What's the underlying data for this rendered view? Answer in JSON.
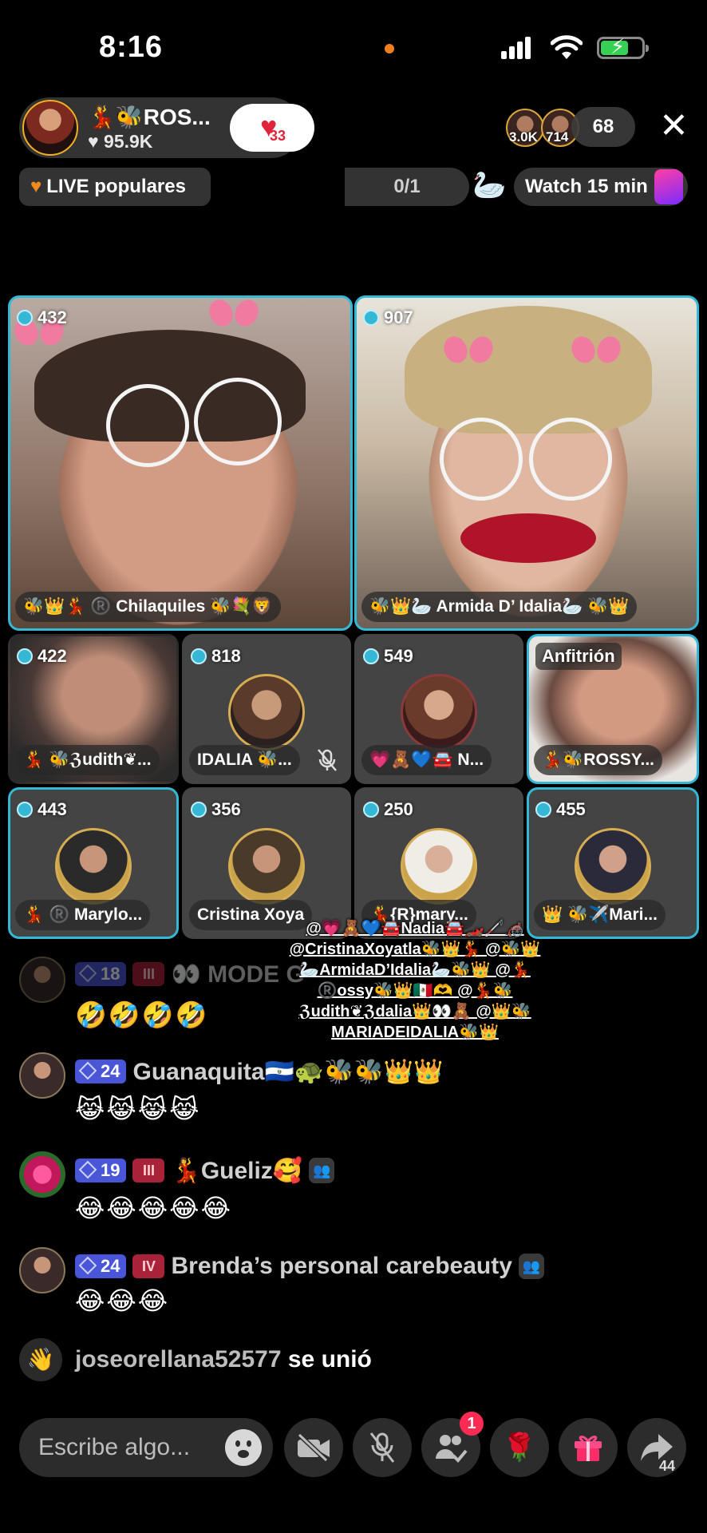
{
  "status": {
    "time": "8:16"
  },
  "host": {
    "name": "💃🐝ROS...",
    "likes": "95.9K",
    "follow_count": "33"
  },
  "viewers": {
    "top": [
      "3.0K",
      "714"
    ],
    "count": "68"
  },
  "pills": {
    "popular": "LIVE populares",
    "progress": "0/1",
    "watch": "Watch 15 min"
  },
  "tiles": [
    {
      "score": "432",
      "label": "🐝👑💃 ®️ Chilaquiles 🐝💐🦁"
    },
    {
      "score": "907",
      "label": "🐝👑🦢 Armida D’ Idalia🦢 🐝👑"
    },
    {
      "score": "422",
      "label": "💃 🐝ℨudith❦..."
    },
    {
      "score": "818",
      "label": "IDALIA 🐝..."
    },
    {
      "score": "549",
      "label": "💗🧸💙🚘 N..."
    },
    {
      "score": "",
      "label": "💃🐝ROSSY...",
      "host_label": "Anfitrión"
    },
    {
      "score": "443",
      "label": "💃 ®️ Marylo..."
    },
    {
      "score": "356",
      "label": "Cristina Xoya"
    },
    {
      "score": "250",
      "label": "💃{R}mary..."
    },
    {
      "score": "455",
      "label": "👑 🐝✈️Mari..."
    }
  ],
  "mention": "@💗🧸💙🚘Nadia🚘🏎️🦯🦽 @CristinaXoyatla🐝👑💃 @🐝👑🦢ArmidaD’Idalia🦢🐝👑 @💃®️ossy🐝👑🇲🇽🫶 @💃🐝ℨudith❦ℨdalia👑👀🧸 @👑🐝MARIADEIDALIA🐝👑",
  "comments": [
    {
      "level": "18",
      "rank": "III",
      "name": "👀 MODE G",
      "body": "🤣🤣🤣🤣"
    },
    {
      "level": "24",
      "rank": "",
      "name": "Guanaquita🇸🇻🐢🐝🐝👑👑",
      "body": "😹😹😹😹"
    },
    {
      "level": "19",
      "rank": "III",
      "name": "💃Gueliz🥰",
      "body": "😂😂😂😂😂"
    },
    {
      "level": "24",
      "rank": "IV",
      "name": "Brenda’s personal carebeauty",
      "body": "😂😂😂"
    }
  ],
  "join": {
    "user": "joseorellana52577",
    "text": "se unió"
  },
  "bottom": {
    "placeholder": "Escribe algo...",
    "notif": "1",
    "share_count": "44"
  }
}
